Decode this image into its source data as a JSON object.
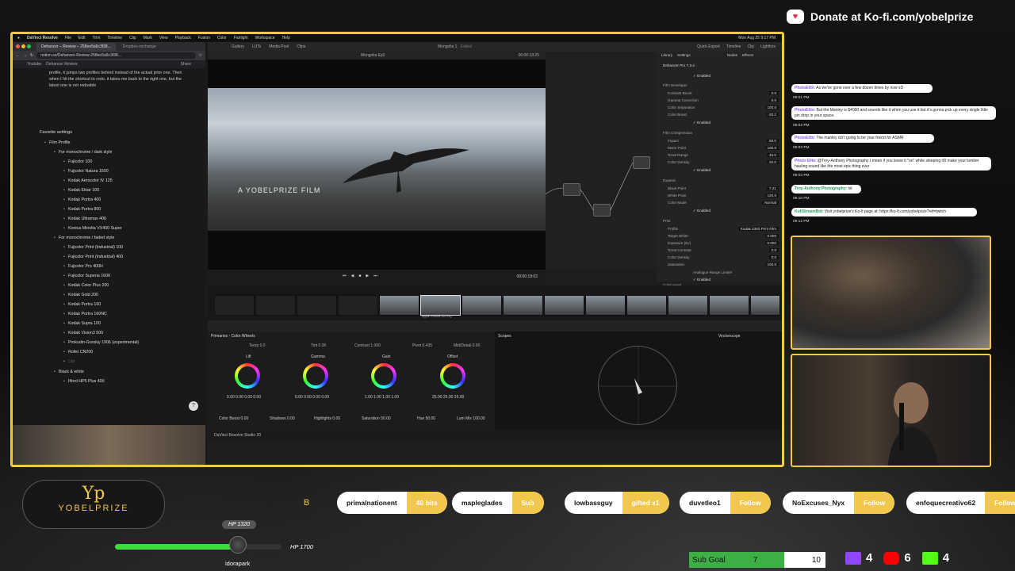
{
  "mac": {
    "app": "DaVinci Resolve",
    "menus": [
      "File",
      "Edit",
      "Trim",
      "Timeline",
      "Clip",
      "Mark",
      "View",
      "Playback",
      "Fusion",
      "Color",
      "Fairlight",
      "Workspace",
      "Help"
    ],
    "datetime": "Mon Aug 25 9:17 PM"
  },
  "browser": {
    "tabs": [
      "Dehancer – Review – 258ee5a6c3f38...",
      "Dropbox exchange"
    ],
    "url": "notion.so/Dehancer-Review-258ee5a6c3f38...",
    "bookmarks": [
      "Youtube",
      "Dehancer Review"
    ],
    "share": "Share"
  },
  "notion": {
    "intro": "profile, it jumps two profiles behind instead of the actual prior one. Then when I hit the shortcut to redo, it takes me back to the right one, but the latest one is not redoable",
    "heading": "Favorite settings",
    "film_profile": "Film Profile",
    "group1": "For monochrome / dark style",
    "list1": [
      "Fujicolor 100",
      "Fujicolor Natura 1600",
      "Kodak Aerocolor IV 125",
      "Kodak Ektar 100",
      "Kodak Portra 400",
      "Kodak Portra 800",
      "Kodak Ultramax 400",
      "Konica Minolta VX400 Super"
    ],
    "group2": "For monochrome / faded style",
    "list2": [
      "Fujicolor Print (Industrial) 100",
      "Fujicolor Print (Industrial) 400",
      "Fujicolor Pro 400H",
      "Fujicolor Superia 1600",
      "Kodak Color Plus 200",
      "Kodak Gold 200",
      "Kodak Portra 160",
      "Kodak Portra 160NC",
      "Kodak Supra 100",
      "Kodak Vision3 500",
      "Prokudin-Gorskiy 1906 (experimental)",
      "Rollei CN200",
      "List"
    ],
    "bw": "Black & white",
    "bwlist": [
      "Ilford HP5 Plus 400"
    ]
  },
  "resolve": {
    "top": [
      "Gallery",
      "LUTs",
      "Media Pool",
      "Clips"
    ],
    "project": "Mongolia 1",
    "edited": "Edited",
    "right_top": [
      "Quick Export",
      "Timeline",
      "Clip",
      "Lightbox"
    ],
    "viewer_clip": "Mongolia Ep2",
    "viewer_tc": "00:00:19:25",
    "film_title": "A YOBELPRIZE FILM",
    "transport_tc": "00:00:19:02",
    "panel_tabs": [
      "Library",
      "Settings",
      "Nodes",
      "Effects"
    ],
    "plugin": "Dehancer Pro 7.3.4",
    "enabled": "Enabled",
    "sections": [
      "Film Developer",
      "Film Compression",
      "Expand",
      "Print",
      "Color Head"
    ],
    "params": [
      {
        "k": "Contrast Boost",
        "v": "0.0"
      },
      {
        "k": "Gamma Correction",
        "v": "0.0"
      },
      {
        "k": "Color Separation",
        "v": "100.0"
      },
      {
        "k": "Color Boost",
        "v": "-30.2"
      },
      {
        "k": "Impact",
        "v": "60.0"
      },
      {
        "k": "Mono Point",
        "v": "100.0"
      },
      {
        "k": "Tonal Range",
        "v": "45.0"
      },
      {
        "k": "Color Density",
        "v": "20.0"
      },
      {
        "k": "Black Point",
        "v": "7.21"
      },
      {
        "k": "White Point",
        "v": "120.0"
      },
      {
        "k": "Color Mode",
        "v": "Normal"
      },
      {
        "k": "Profile",
        "v": "Kodak 2383 Print Film"
      },
      {
        "k": "Target White",
        "v": "0.000"
      },
      {
        "k": "Exposure (Ev)",
        "v": "0.000"
      },
      {
        "k": "Tonal Contrast",
        "v": "0.0"
      },
      {
        "k": "Color Density",
        "v": "0.0"
      },
      {
        "k": "Saturation",
        "v": "100.0"
      }
    ],
    "analogue": "Analogue Range Limiter",
    "wheels_title": "Primaries - Color Wheels",
    "scopes": "Scopes",
    "vectorscope": "Vectorscope",
    "wheel_params": {
      "temp": "Temp",
      "temp_v": "0.0",
      "tint": "Tint",
      "tint_v": "0.00",
      "contrast": "Contrast",
      "contrast_v": "1.000",
      "pivot": "Pivot",
      "pivot_v": "0.435",
      "mid": "Mid/Detail",
      "mid_v": "0.00"
    },
    "wheels": [
      {
        "name": "Lift",
        "vals": "0.00  0.00  0.00  0.00"
      },
      {
        "name": "Gamma",
        "vals": "0.00  0.00  0.00  0.00"
      },
      {
        "name": "Gain",
        "vals": "1.00  1.00  1.00  1.00"
      },
      {
        "name": "Offset",
        "vals": "25.00  25.00  25.00"
      }
    ],
    "bottom_params": {
      "boost": "Color Boost",
      "boost_v": "0.00",
      "shadows": "Shadows",
      "shadows_v": "0.00",
      "highlights": "Highlights",
      "highlights_v": "0.00",
      "saturation": "Saturation",
      "saturation_v": "50.00",
      "hue": "Hue",
      "hue_v": "50.00",
      "lum": "Lum Mix",
      "lum_v": "100.00"
    },
    "footer": "DaVinci Resolve Studio 20",
    "clip_label": "Apple ProRes 422 HQ"
  },
  "kofi": {
    "text": "Donate at Ko-fi.com/yobelprize"
  },
  "chat": [
    {
      "user": "PhotoElite",
      "text": ": As we've gone over a few dozen times by now xD",
      "time": "09:01 PM"
    },
    {
      "user": "PhotoElite",
      "text": ": But the Manley is $4000 and sounds like it when you use it but it's gonna pick up every single little pin drop in your space.",
      "time": "09:02 PM"
    },
    {
      "user": "PhotoElite",
      "text": ": The manley isn't going to be your friend for ASMR",
      "time": "09:03 PM"
    },
    {
      "user": "Photo Elite",
      "text": ": @Troy-Anthony Photography I mean if you leave it \"on\" while sleeping it'll make your lumber hauling sound like the most epic thing ever",
      "time": "09:04 PM"
    },
    {
      "user": "Troy-Anthony Photography",
      "text": ": lol",
      "time": "09:10 PM"
    },
    {
      "user": "KofiStreamBot",
      "text": ": Visit yobelprize's Ko-fi page at: https://ko-fi.com/yobelprize?ref=twitch",
      "time": "09:12 PM"
    }
  ],
  "logo": {
    "mark": "Yp",
    "name": "YOBELPRIZE",
    "b": "B"
  },
  "ticker": [
    {
      "user": "primalnationent",
      "action": "40 bits"
    },
    {
      "user": "mapleglades",
      "action": "Sub"
    },
    {
      "user": "lowbassguy",
      "action": "gifted x1"
    },
    {
      "user": "duvetleo1",
      "action": "Follow"
    },
    {
      "user": "NoExcuses_Nyx",
      "action": "Follow"
    },
    {
      "user": "enfoquecreativo62",
      "action": "Follow"
    }
  ],
  "hp": {
    "top": "HP 1320",
    "right": "HP 1700",
    "user": "idorapark",
    "fill": 0.77
  },
  "subgoal": {
    "label": "Sub Goal",
    "current": "7",
    "goal": "10",
    "fraction": 0.7
  },
  "counts": {
    "twitch": "4",
    "youtube": "6",
    "kick": "4"
  },
  "colors": {
    "accent": "#f1c84b",
    "green": "#3cdc3c"
  }
}
